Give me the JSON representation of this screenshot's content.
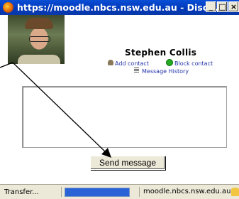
{
  "window": {
    "title": "https://moodle.nbcs.nsw.edu.au - Disc...",
    "minimize_label": "_",
    "maximize_label": "□",
    "close_label": "×"
  },
  "profile": {
    "name": "Stephen Collis",
    "add_contact": "Add contact",
    "block_contact": "Block contact",
    "message_history": "Message History"
  },
  "message": {
    "input_value": "",
    "send_label": "Send message"
  },
  "statusbar": {
    "left_text": "Transfer...",
    "right_text": "moodle.nbcs.nsw.edu.au",
    "progress": 1.0
  },
  "colors": {
    "titlebar": "#0a4fd6",
    "link": "#2233aa",
    "block_icon": "#22aa22"
  }
}
